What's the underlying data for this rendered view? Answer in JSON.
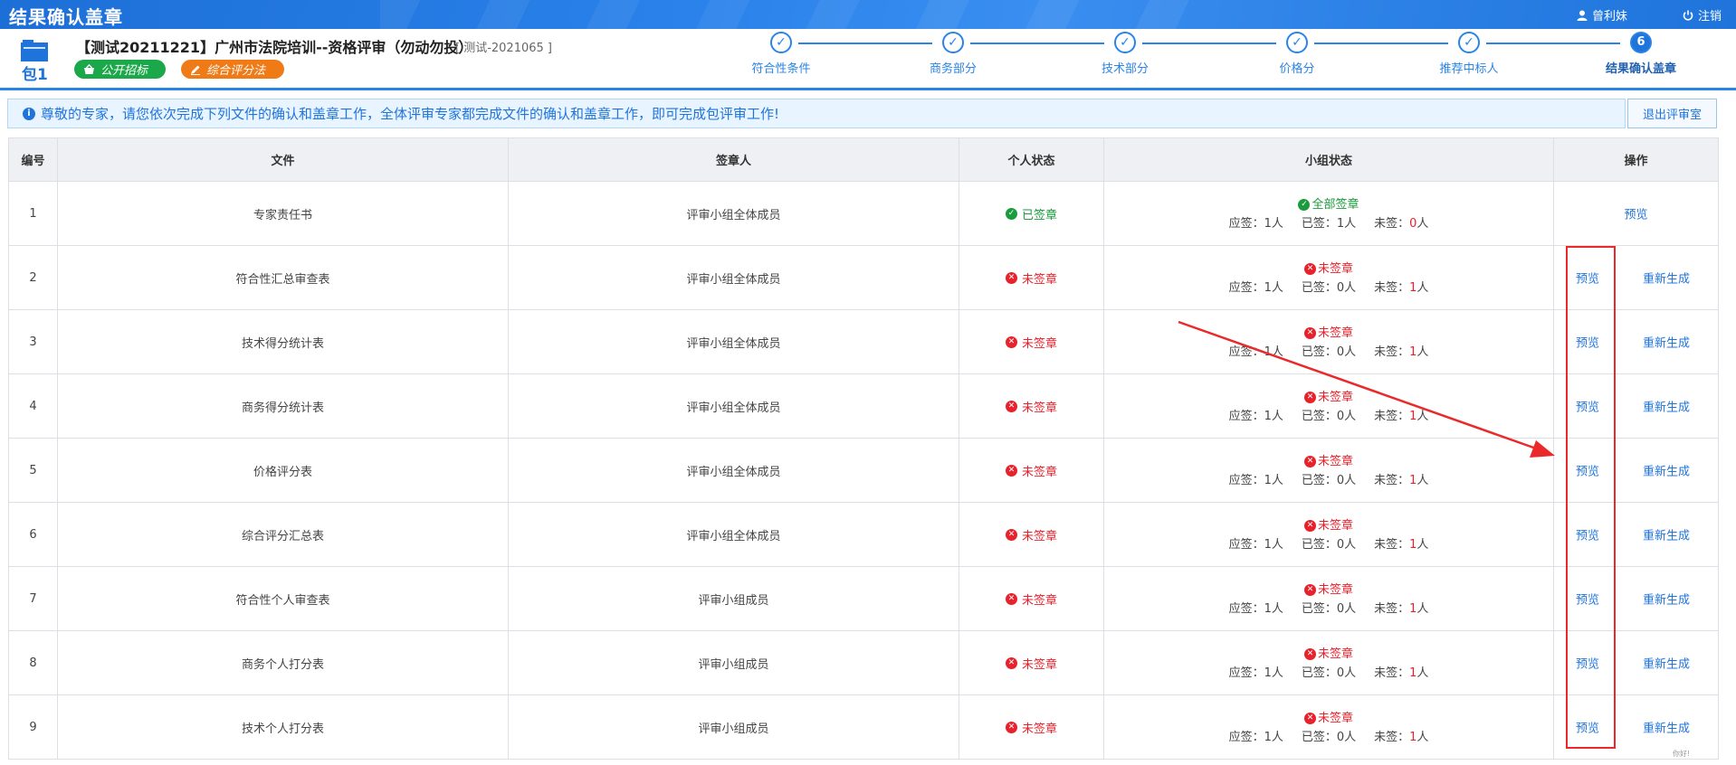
{
  "app": {
    "title": "结果确认盖章"
  },
  "user": {
    "name": "曾利妹",
    "logout": "注销"
  },
  "project": {
    "package": "包1",
    "title": "【测试20211221】广州市法院培训--资格评审（勿动勿投）",
    "code": "[ 测试-2021065 ]",
    "tags": [
      "公开招标",
      "综合评分法"
    ]
  },
  "steps": [
    {
      "label": "符合性条件",
      "mark": "✓"
    },
    {
      "label": "商务部分",
      "mark": "✓"
    },
    {
      "label": "技术部分",
      "mark": "✓"
    },
    {
      "label": "价格分",
      "mark": "✓"
    },
    {
      "label": "推荐中标人",
      "mark": "✓"
    },
    {
      "label": "结果确认盖章",
      "mark": "6"
    }
  ],
  "notice": "尊敬的专家，请您依次完成下列文件的确认和盖章工作，全体评审专家都完成文件的确认和盖章工作，即可完成包评审工作!",
  "exit_button": "退出评审室",
  "table": {
    "headers": [
      "编号",
      "文件",
      "签章人",
      "个人状态",
      "小组状态",
      "操作"
    ],
    "rows": [
      {
        "no": "1",
        "file": "专家责任书",
        "signer": "评审小组全体成员",
        "personal": "已签章",
        "group": "全部签章",
        "should": "应签：1人",
        "signed": "已签：1人",
        "unsigned_label": "未签：",
        "unsigned_num": "0",
        "unsigned_unit": "人",
        "preview": "预览",
        "regen": ""
      },
      {
        "no": "2",
        "file": "符合性汇总审查表",
        "signer": "评审小组全体成员",
        "personal": "未签章",
        "group": "未签章",
        "should": "应签：1人",
        "signed": "已签：0人",
        "unsigned_label": "未签：",
        "unsigned_num": "1",
        "unsigned_unit": "人",
        "preview": "预览",
        "regen": "重新生成"
      },
      {
        "no": "3",
        "file": "技术得分统计表",
        "signer": "评审小组全体成员",
        "personal": "未签章",
        "group": "未签章",
        "should": "应签：1人",
        "signed": "已签：0人",
        "unsigned_label": "未签：",
        "unsigned_num": "1",
        "unsigned_unit": "人",
        "preview": "预览",
        "regen": "重新生成"
      },
      {
        "no": "4",
        "file": "商务得分统计表",
        "signer": "评审小组全体成员",
        "personal": "未签章",
        "group": "未签章",
        "should": "应签：1人",
        "signed": "已签：0人",
        "unsigned_label": "未签：",
        "unsigned_num": "1",
        "unsigned_unit": "人",
        "preview": "预览",
        "regen": "重新生成"
      },
      {
        "no": "5",
        "file": "价格评分表",
        "signer": "评审小组全体成员",
        "personal": "未签章",
        "group": "未签章",
        "should": "应签：1人",
        "signed": "已签：0人",
        "unsigned_label": "未签：",
        "unsigned_num": "1",
        "unsigned_unit": "人",
        "preview": "预览",
        "regen": "重新生成"
      },
      {
        "no": "6",
        "file": "综合评分汇总表",
        "signer": "评审小组全体成员",
        "personal": "未签章",
        "group": "未签章",
        "should": "应签：1人",
        "signed": "已签：0人",
        "unsigned_label": "未签：",
        "unsigned_num": "1",
        "unsigned_unit": "人",
        "preview": "预览",
        "regen": "重新生成"
      },
      {
        "no": "7",
        "file": "符合性个人审查表",
        "signer": "评审小组成员",
        "personal": "未签章",
        "group": "未签章",
        "should": "应签：1人",
        "signed": "已签：0人",
        "unsigned_label": "未签：",
        "unsigned_num": "1",
        "unsigned_unit": "人",
        "preview": "预览",
        "regen": "重新生成"
      },
      {
        "no": "8",
        "file": "商务个人打分表",
        "signer": "评审小组成员",
        "personal": "未签章",
        "group": "未签章",
        "should": "应签：1人",
        "signed": "已签：0人",
        "unsigned_label": "未签：",
        "unsigned_num": "1",
        "unsigned_unit": "人",
        "preview": "预览",
        "regen": "重新生成"
      },
      {
        "no": "9",
        "file": "技术个人打分表",
        "signer": "评审小组成员",
        "personal": "未签章",
        "group": "未签章",
        "should": "应签：1人",
        "signed": "已签：0人",
        "unsigned_label": "未签：",
        "unsigned_num": "1",
        "unsigned_unit": "人",
        "preview": "预览",
        "regen": "重新生成"
      }
    ]
  },
  "colors": {
    "primary": "#1f74dc",
    "success": "#1a9b3c",
    "danger": "#e8222c",
    "annotation": "#ea2a2a"
  },
  "corner_note": "你好!"
}
